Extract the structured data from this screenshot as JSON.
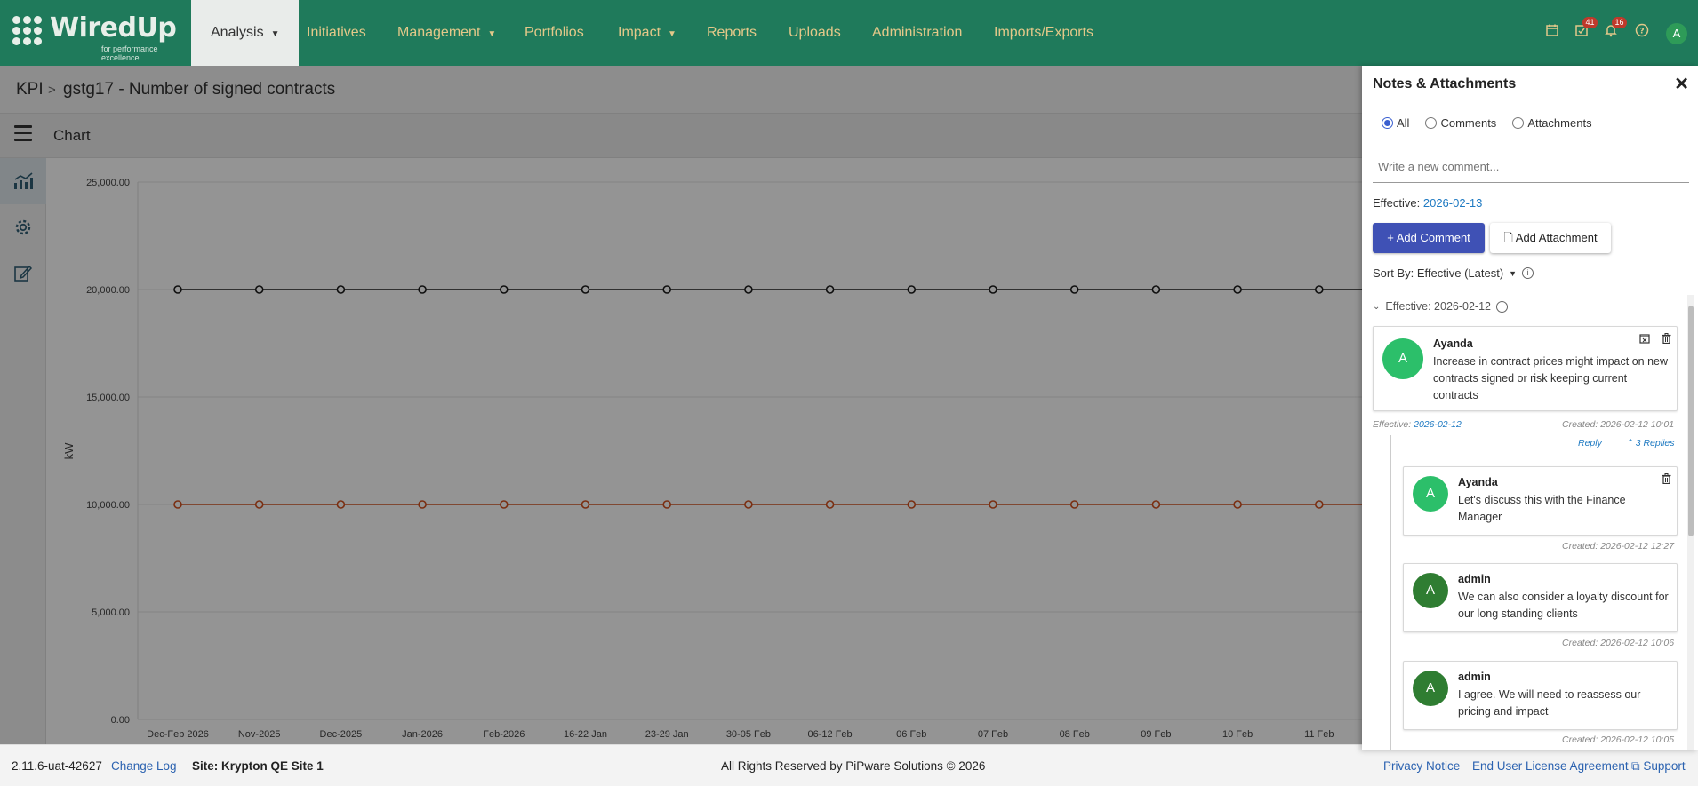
{
  "nav": {
    "logo_text": "WiredUp",
    "logo_tagline": "for performance excellence",
    "items": [
      "Analysis",
      "Initiatives",
      "Management",
      "Portfolios",
      "Impact",
      "Reports",
      "Uploads",
      "Administration",
      "Imports/Exports"
    ],
    "badges": {
      "tasks": "41",
      "notifications": "16"
    },
    "avatar_initial": "A",
    "icons": [
      "calendar-icon",
      "tasks-icon",
      "bell-icon",
      "help-icon"
    ]
  },
  "breadcrumb": {
    "root": "KPI",
    "separator": ">",
    "current": "gstg17 - Number of signed contracts"
  },
  "toolbar": {
    "title": "Chart"
  },
  "rail": {
    "icons": [
      "chart-icon",
      "gear-icon",
      "edit-icon"
    ]
  },
  "chart_data": {
    "type": "line",
    "ylabel": "kW",
    "xlabel": "",
    "title": "",
    "ylim": [
      0,
      25000
    ],
    "y_ticks": [
      "0.00",
      "5,000.00",
      "10,000.00",
      "15,000.00",
      "20,000.00",
      "25,000.00"
    ],
    "categories": [
      "Dec-Feb 2026",
      "Nov-2025",
      "Dec-2025",
      "Jan-2026",
      "Feb-2026",
      "16-22 Jan",
      "23-29 Jan",
      "30-05 Feb",
      "06-12 Feb",
      "06 Feb",
      "07 Feb",
      "08 Feb",
      "09 Feb",
      "10 Feb",
      "11 Feb"
    ],
    "series": [
      {
        "color": "#1a1a1a",
        "values": [
          20000,
          20000,
          20000,
          20000,
          20000,
          20000,
          20000,
          20000,
          20000,
          20000,
          20000,
          20000,
          20000,
          20000,
          20000
        ]
      },
      {
        "color": "#d2501e",
        "values": [
          10000,
          10000,
          10000,
          10000,
          10000,
          10000,
          10000,
          10000,
          10000,
          10000,
          10000,
          10000,
          10000,
          10000,
          10000
        ]
      }
    ],
    "grid": true
  },
  "footer": {
    "version": "2.11.6-uat-42627",
    "change_log": "Change Log",
    "site": "Site: Krypton QE Site 1",
    "copyright": "All Rights Reserved by PiPware Solutions © 2026",
    "privacy": "Privacy Notice",
    "eula": "End User License Agreement",
    "support": "Support"
  },
  "panel": {
    "title": "Notes & Attachments",
    "close": "✕",
    "filters": [
      "All",
      "Comments",
      "Attachments"
    ],
    "selected_filter": "All",
    "comment_placeholder": "Write a new comment...",
    "effective_label": "Effective:",
    "effective_date": "2026-02-13",
    "add_comment": "+ Add Comment",
    "add_attachment": "Add Attachment",
    "sort_label": "Sort By: Effective (Latest)",
    "group_label": "Effective: 2026-02-12",
    "comment": {
      "initial": "A",
      "author": "Ayanda",
      "text": "Increase in contract prices might impact on new contracts signed or risk keeping current contracts",
      "effective_label": "Effective:",
      "effective_date": "2026-02-12",
      "created": "Created: 2026-02-12 10:01",
      "reply": "Reply",
      "replies": "3 Replies"
    },
    "replies": [
      {
        "initial": "A",
        "author": "Ayanda",
        "text": "Let's discuss this with the Finance Manager",
        "created": "Created: 2026-02-12 12:27",
        "avatar_color": "#2cbf6a"
      },
      {
        "initial": "A",
        "author": "admin",
        "text": "We can also consider a loyalty discount for our long standing clients",
        "created": "Created: 2026-02-12 10:06",
        "avatar_color": "#2f7d32"
      },
      {
        "initial": "A",
        "author": "admin",
        "text": "I agree. We will need to reassess our pricing and impact",
        "created": "Created: 2026-02-12 10:05",
        "avatar_color": "#2f7d32"
      }
    ]
  },
  "colors": {
    "nav_bg": "#1f7a5b",
    "nav_text": "#e3c889",
    "primary_button": "#3f51b5",
    "link": "#1f7ac2"
  }
}
